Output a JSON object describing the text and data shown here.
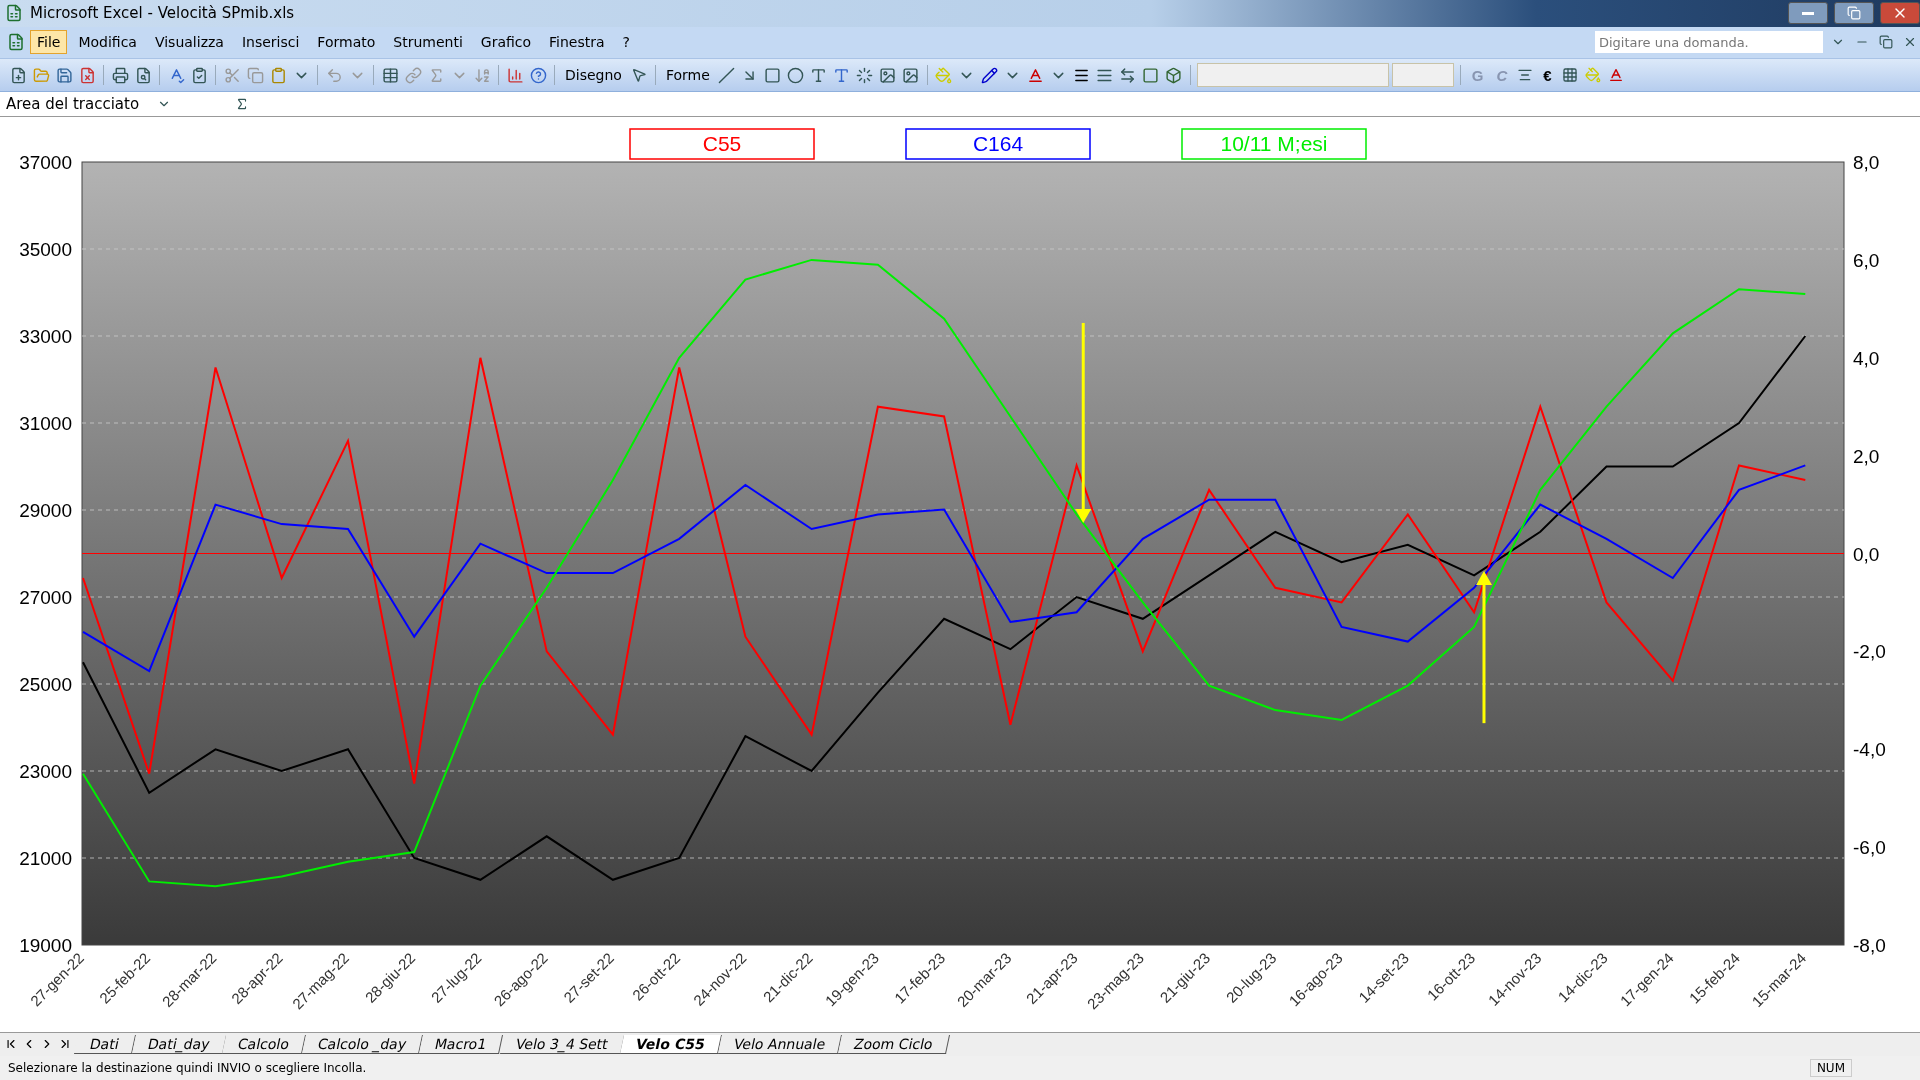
{
  "window": {
    "title": "Microsoft Excel - Velocità SPmib.xls"
  },
  "menu": [
    {
      "label": "File",
      "selected": true
    },
    {
      "label": "Modifica",
      "selected": false
    },
    {
      "label": "Visualizza",
      "selected": false
    },
    {
      "label": "Inserisci",
      "selected": false
    },
    {
      "label": "Formato",
      "selected": false
    },
    {
      "label": "Strumenti",
      "selected": false
    },
    {
      "label": "Grafico",
      "selected": false
    },
    {
      "label": "Finestra",
      "selected": false
    },
    {
      "label": "?",
      "selected": false
    }
  ],
  "help_search": {
    "placeholder": "Digitare una domanda."
  },
  "toolbar": {
    "drawing_menu": "Disegno",
    "shapes_menu": "Forme",
    "bold": "G",
    "italic": "C",
    "currency": "€"
  },
  "name_box": {
    "value": "Area del tracciato"
  },
  "chart": {
    "chart_data": {
      "type": "line",
      "categories": [
        "27-gen-22",
        "25-feb-22",
        "28-mar-22",
        "28-apr-22",
        "27-mag-22",
        "28-giu-22",
        "27-lug-22",
        "26-ago-22",
        "27-set-22",
        "26-ott-22",
        "24-nov-22",
        "21-dic-22",
        "19-gen-23",
        "17-feb-23",
        "20-mar-23",
        "21-apr-23",
        "23-mag-23",
        "21-giu-23",
        "20-lug-23",
        "16-ago-23",
        "14-set-23",
        "16-ott-23",
        "14-nov-23",
        "14-dic-23",
        "17-gen-24",
        "15-feb-24",
        "15-mar-24"
      ],
      "ylim": [
        19000,
        37000
      ],
      "yticks": [
        19000,
        21000,
        23000,
        25000,
        27000,
        29000,
        31000,
        33000,
        35000,
        37000
      ],
      "y2lim": [
        -8,
        8
      ],
      "y2ticks": [
        {
          "value": -8,
          "label": "-8,0"
        },
        {
          "value": -6,
          "label": "-6,0"
        },
        {
          "value": -4,
          "label": "-4,0"
        },
        {
          "value": -2,
          "label": "-2,0"
        },
        {
          "value": 0,
          "label": "0,0"
        },
        {
          "value": 2,
          "label": "2,0"
        },
        {
          "value": 4,
          "label": "4,0"
        },
        {
          "value": 6,
          "label": "6,0"
        },
        {
          "value": 8,
          "label": "8,0"
        }
      ],
      "series": [
        {
          "color": "#000000",
          "values": [
            25500,
            22500,
            23500,
            23000,
            23500,
            21000,
            20500,
            21500,
            20500,
            21000,
            23800,
            23000,
            24800,
            26500,
            25800,
            27000,
            26500,
            27500,
            28500,
            27800,
            28200,
            27500,
            28500,
            30000,
            30000,
            31000,
            33000
          ]
        },
        {
          "name": "C55",
          "color": "#ff0000",
          "axis": "y2",
          "values": [
            -0.5,
            -4.5,
            3.8,
            -0.5,
            2.3,
            -4.7,
            4.0,
            -2.0,
            -3.7,
            3.8,
            -1.7,
            -3.7,
            3.0,
            2.8,
            -3.5,
            1.8,
            -2.0,
            1.3,
            -0.7,
            -1.0,
            0.8,
            -1.2,
            3.0,
            -1.0,
            -2.6,
            1.8,
            1.5
          ]
        },
        {
          "name": "C164",
          "color": "#0000ff",
          "axis": "y2",
          "values": [
            -1.6,
            -2.4,
            1.0,
            0.6,
            0.5,
            -1.7,
            0.2,
            -0.4,
            -0.4,
            0.3,
            1.4,
            0.5,
            0.8,
            0.9,
            -1.4,
            -1.2,
            0.3,
            1.1,
            1.1,
            -1.5,
            -1.8,
            -0.7,
            1.0,
            0.3,
            -0.5,
            1.3,
            1.8
          ]
        },
        {
          "name": "10/11 M;esi",
          "color": "#00ee00",
          "axis": "y2",
          "values": [
            -4.5,
            -6.7,
            -6.8,
            -6.6,
            -6.3,
            -6.1,
            -2.7,
            -0.7,
            1.5,
            4.0,
            5.6,
            6.0,
            5.9,
            4.8,
            2.8,
            0.8,
            -1.0,
            -2.7,
            -3.2,
            -3.4,
            -2.7,
            -1.5,
            1.3,
            3.0,
            4.5,
            5.4,
            5.3
          ]
        }
      ],
      "grid": true,
      "ref_lines": [
        {
          "axis": "y2",
          "value": 0,
          "color": "#ff0000"
        }
      ]
    }
  },
  "sheet_tabs": [
    {
      "label": "Dati",
      "selected": false
    },
    {
      "label": "Dati_day",
      "selected": false
    },
    {
      "label": "Calcolo",
      "selected": false
    },
    {
      "label": "Calcolo _day",
      "selected": false
    },
    {
      "label": "Macro1",
      "selected": false
    },
    {
      "label": "Velo 3_4 Sett",
      "selected": false
    },
    {
      "label": "Velo C55",
      "selected": true
    },
    {
      "label": "Velo Annuale",
      "selected": false
    },
    {
      "label": "Zoom Ciclo",
      "selected": false
    }
  ],
  "status_bar": {
    "message": "Selezionare la destinazione quindi INVIO o scegliere Incolla.",
    "indicator": "NUM"
  }
}
